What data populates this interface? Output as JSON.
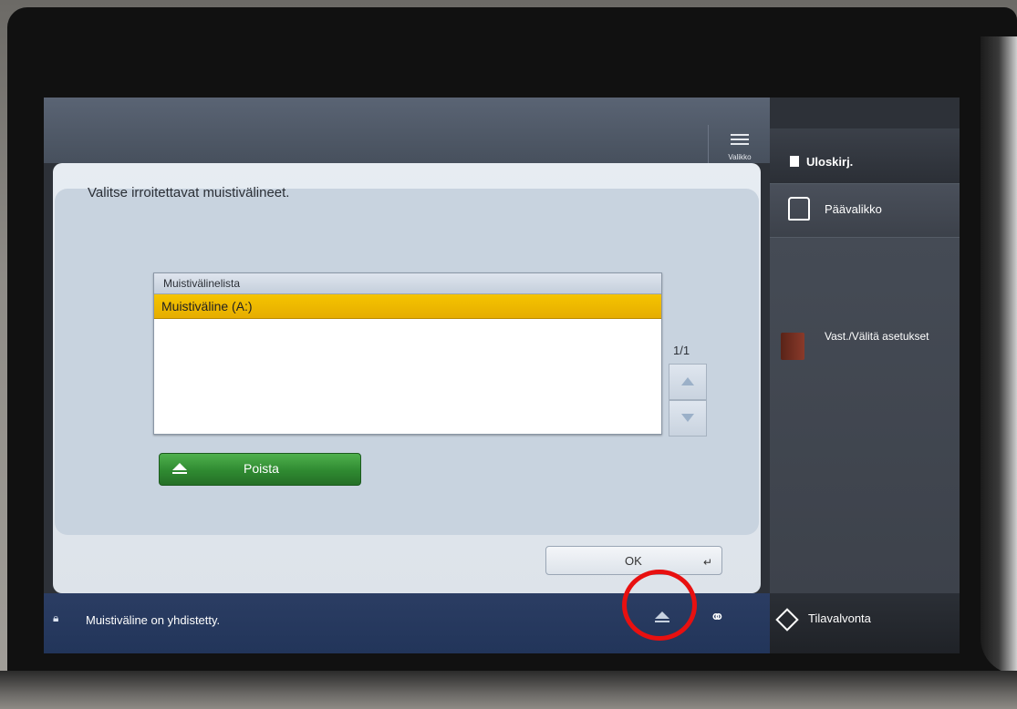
{
  "header": {
    "menu_label": "Valikko"
  },
  "main": {
    "instruction": "Valitse irroitettavat muistivälineet.",
    "list_header": "Muistivälinelista",
    "list_items": [
      "Muistiväline (A:)"
    ],
    "page_indicator": "1/1",
    "remove_button": "Poista",
    "ok_button": "OK"
  },
  "status_bar": {
    "message": "Muistiväline on yhdistetty."
  },
  "sidebar": {
    "logout": "Uloskirj.",
    "home": "Päävalikko",
    "favorite": "Vast./Välitä asetukset",
    "status_monitor": "Tilavalvonta"
  },
  "colors": {
    "selected_row": "#f0b800",
    "remove_button": "#2f8a31",
    "status_bar": "#22355a",
    "annotation_circle": "#e81010"
  },
  "icons": [
    "menu-icon",
    "eject-icon",
    "lock-icon",
    "link-icon",
    "logout-icon",
    "home-icon",
    "book-icon",
    "eye-icon",
    "up-arrow-icon",
    "down-arrow-icon"
  ]
}
